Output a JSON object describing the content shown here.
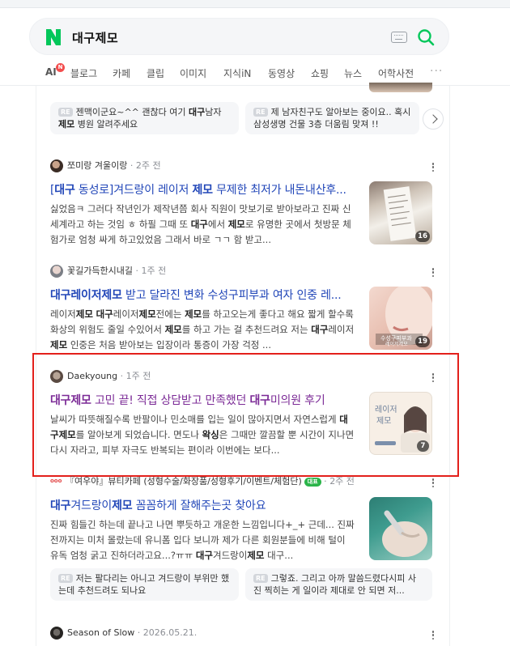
{
  "search": {
    "query": "대구제모",
    "logo_letter": "N"
  },
  "tabs": [
    {
      "label": "AI",
      "badge": "N"
    },
    {
      "label": "블로그"
    },
    {
      "label": "카페"
    },
    {
      "label": "클립"
    },
    {
      "label": "이미지"
    },
    {
      "label": "지식iN"
    },
    {
      "label": "동영상"
    },
    {
      "label": "쇼핑"
    },
    {
      "label": "뉴스"
    },
    {
      "label": "어학사전"
    }
  ],
  "top_chips": [
    {
      "tag": "RE",
      "text_a": "젠맥이군요~^^ 괜찮다 여기 ",
      "bold_a": "대구",
      "text_b": "남자 ",
      "bold_b": "제모",
      "text_c": " 병원 알려주세요"
    },
    {
      "tag": "RE",
      "text_a": "제 남자친구도 알아보는 중이요.. 혹시 삼성생명 건물 3층 더움림 맞져 !!"
    }
  ],
  "results": [
    {
      "author": "쪼미랑 겨울이랑",
      "time": "2주 전",
      "title_a": "[",
      "title_b1": "대구",
      "title_c": " 동성로]겨드랑이 레이저 ",
      "title_b2": "제모",
      "title_d": " 무제한 최저가 내돈내산후...",
      "desc": [
        {
          "t": "싫었음ㅋ 그러다 작년인가 제작년쯤 회사 직원이 맛보기로 받아보라고 진짜 신세계라고 하는 것임 ㅎ 하필 그때 또 "
        },
        {
          "b": "대구"
        },
        {
          "t": "에서 "
        },
        {
          "b": "제모"
        },
        {
          "t": "로 유명한 곳에서 첫방문 체험가로 엄청 싸게 하고있었음 그래서 바로 ㄱㄱ 함 받고..."
        }
      ],
      "thumb_count": "16"
    },
    {
      "author": "꽃길가득한시내길",
      "time": "1주 전",
      "title_a": "",
      "title_b1": "대구레이저제모",
      "title_c": " 받고 달라진 변화 수성구피부과 여자 인중 레...",
      "title_b2": "",
      "title_d": "",
      "desc": [
        {
          "t": "레이저"
        },
        {
          "b": "제모"
        },
        {
          "t": " "
        },
        {
          "b": "대구"
        },
        {
          "t": "레이저"
        },
        {
          "b": "제모"
        },
        {
          "t": "전에는 "
        },
        {
          "b": "제모"
        },
        {
          "t": "를 하고오는게 좋다고 해요 짧게 할수록 화상의 위험도 줄일 수있어서 "
        },
        {
          "b": "제모"
        },
        {
          "t": "를 하고 가는 걸 추천드려요 저는 "
        },
        {
          "b": "대구"
        },
        {
          "t": "레이저"
        },
        {
          "b": "제모"
        },
        {
          "t": " 인중은 처음 받아보는 입장이라 통증이 가장 걱정 ..."
        }
      ],
      "thumb_count": "19",
      "thumb_caption": "수성구피부과\n레이저제모"
    },
    {
      "author": "Daekyoung",
      "time": "1주 전",
      "title_a": "",
      "title_b1": "대구제모",
      "title_c": " 고민 끝! 직접 상담받고 만족했던 ",
      "title_b2": "대구",
      "title_d": "미의원 후기",
      "desc": [
        {
          "t": "날씨가 따뜻해질수록 반팔이나 민소매를 입는 일이 많아지면서 자연스럽게 "
        },
        {
          "b": "대구제모"
        },
        {
          "t": "를 알아보게 되었습니다. 면도나 "
        },
        {
          "b": "왁싱"
        },
        {
          "t": "은 그때만 깔끔할 뿐 시간이 지나면 다시 자라고, 피부 자극도 반복되는 편이라 이번에는 보다..."
        }
      ],
      "thumb_count": "7",
      "thumb_caption": "레이저\n제모"
    },
    {
      "author": "『여우야』뷰티카페 (성형수술/화장품/성형후기/이벤트/체험단)",
      "author_badge": "대표",
      "time": "2주 전",
      "title_a": "",
      "title_b1": "대구",
      "title_c": "겨드랑이",
      "title_b2": "제모",
      "title_d": " 꼼꼼하게 잘해주는곳 찾아요",
      "desc": [
        {
          "t": "진짜 힘들긴 하는데 끝나고 나면 뿌듯하고 개운한 느낌입니다+_+ 근데... 진짜 전까지는 미처 몰랐는데 유니폼 입다 보니까 제가 다른 회원분들에 비해 털이 유독 엄청 굵고 진하더라고요...?ㅠㅠ "
        },
        {
          "b": "대구"
        },
        {
          "t": "겨드랑이"
        },
        {
          "b": "제모"
        },
        {
          "t": " 대구..."
        }
      ]
    },
    {
      "author": "Season of Slow",
      "time": "2026.05.21."
    }
  ],
  "bottom_chips": [
    {
      "tag": "RE",
      "text": "저는 팔다리는 아니고 겨드랑이 부위만 했는데 추천드려도 되나요"
    },
    {
      "tag": "RE",
      "text": "그렇죠. 그리고 아까 말씀드렸다시피 사진 찍히는 게 일이라 제대로 안 되면 저..."
    }
  ],
  "colors": {
    "link": "#2146b8",
    "visited": "#7b2a96",
    "brand_green": "#03c75a",
    "highlight_border": "#e3201b"
  }
}
